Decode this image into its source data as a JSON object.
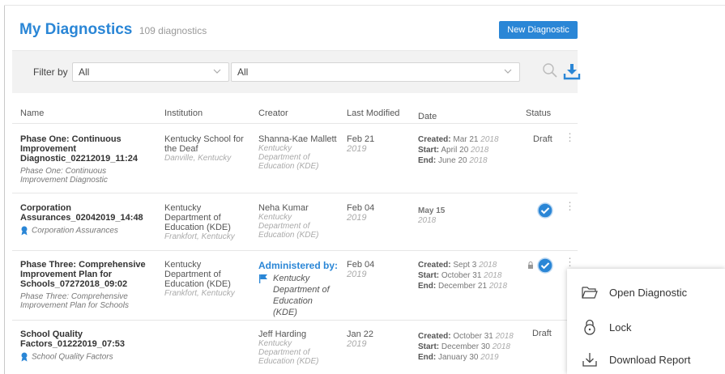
{
  "header": {
    "title": "My Diagnostics",
    "count": "109 diagnostics",
    "new_button": "New Diagnostic"
  },
  "filter": {
    "label": "Filter by",
    "select1": "All",
    "select2": "All"
  },
  "columns": [
    "Name",
    "Institution",
    "Creator",
    "Last Modified",
    "Date",
    "Status"
  ],
  "rows": [
    {
      "name": "Phase One: Continuous Improvement Diagnostic_02212019_11:24",
      "subtitle": "Phase One: Continuous Improvement Diagnostic",
      "institution": "Kentucky School for the Deaf",
      "institution_loc": "Danville, Kentucky",
      "creator": "Shanna-Kae Mallett",
      "creator_org": "Kentucky Department of Education (KDE)",
      "modified": "Feb 21",
      "modified_year": "2019",
      "created_label": "Created:",
      "created": "Mar 21",
      "created_year": "2018",
      "start_label": "Start:",
      "start": "April 20",
      "start_year": "2018",
      "end_label": "End:",
      "end": "June 20",
      "end_year": "2018",
      "status": "Draft"
    },
    {
      "name": "Corporation Assurances_02042019_14:48",
      "subtitle": "Corporation Assurances",
      "institution": "Kentucky Department of Education (KDE)",
      "institution_loc": "Frankfort, Kentucky",
      "creator": "Neha Kumar",
      "creator_org": "Kentucky Department of Education (KDE)",
      "modified": "Feb 04",
      "modified_year": "2019",
      "date_main": "May 15",
      "date_year": "2018",
      "status": ""
    },
    {
      "name": "Phase Three: Comprehensive Improvement Plan for Schools_07272018_09:02",
      "subtitle": "Phase Three: Comprehensive Improvement Plan for Schools",
      "institution": "Kentucky Department of Education (KDE)",
      "institution_loc": "Frankfort, Kentucky",
      "admin_label": "Administered by:",
      "admin_org": "Kentucky Department of Education (KDE)",
      "modified": "Feb 04",
      "modified_year": "2019",
      "created_label": "Created:",
      "created": "Sept 3",
      "created_year": "2018",
      "start_label": "Start:",
      "start": "October 31",
      "start_year": "2018",
      "end_label": "End:",
      "end": "December 21",
      "end_year": "2018",
      "status": ""
    },
    {
      "name": "School Quality Factors_01222019_07:53",
      "subtitle": "School Quality Factors",
      "creator": "Jeff Harding",
      "creator_org": "Kentucky Department of Education (KDE)",
      "modified": "Jan 22",
      "modified_year": "2019",
      "created_label": "Created:",
      "created": "October 31",
      "created_year": "2018",
      "start_label": "Start:",
      "start": "December 30",
      "start_year": "2018",
      "end_label": "End:",
      "end": "January 30",
      "end_year": "2019",
      "status": "Draft"
    }
  ],
  "menu": {
    "open": "Open Diagnostic",
    "lock": "Lock",
    "download": "Download Report"
  },
  "colors": {
    "accent": "#2a86d6",
    "filter_bg": "#f2f2f2"
  }
}
